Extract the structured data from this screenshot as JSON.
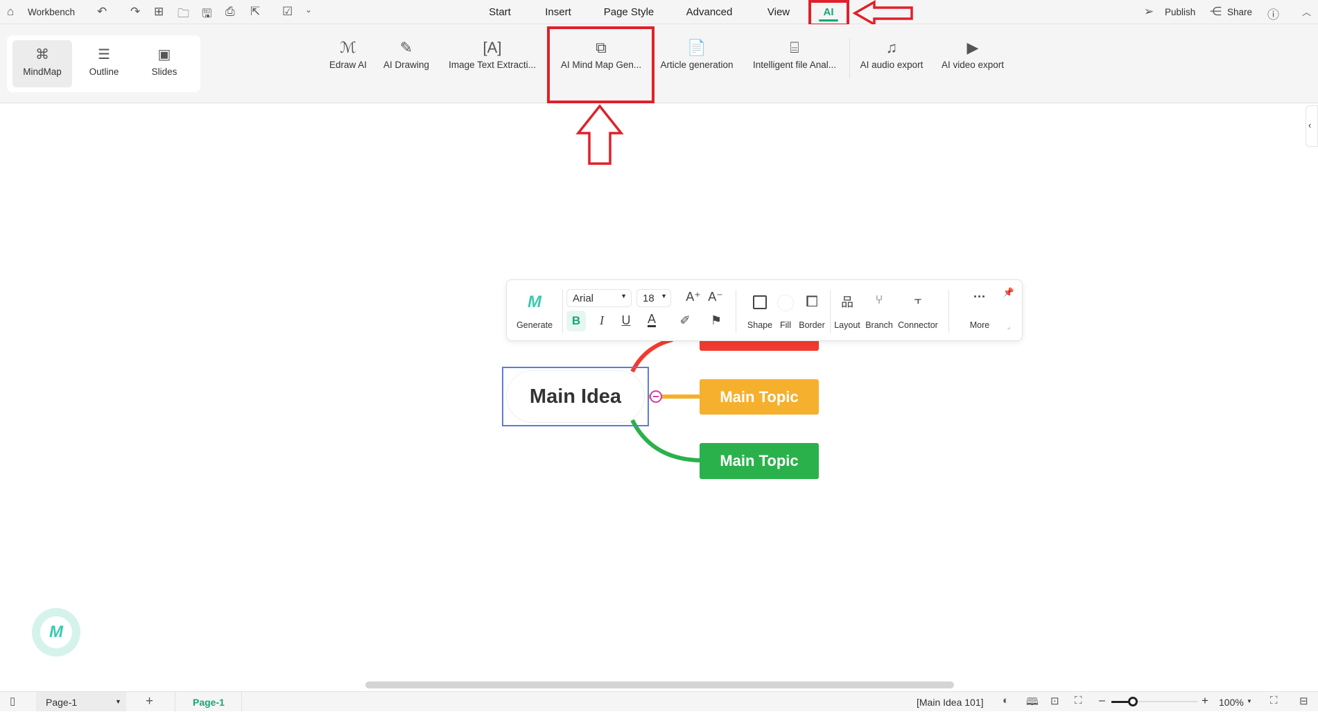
{
  "topbar": {
    "workbench": "Workbench",
    "menu": [
      "Start",
      "Insert",
      "Page Style",
      "Advanced",
      "View",
      "AI"
    ],
    "active_menu": "AI",
    "publish": "Publish",
    "share": "Share"
  },
  "views": [
    "MindMap",
    "Outline",
    "Slides"
  ],
  "ai_tools": [
    "Edraw AI",
    "AI Drawing",
    "Image Text Extracti...",
    "AI Mind Map Gen...",
    "Article generation",
    "Intelligent file Anal...",
    "AI audio export",
    "AI video export"
  ],
  "floating_toolbar": {
    "generate": "Generate",
    "font": "Arial",
    "size": "18",
    "bold": "B",
    "italic": "I",
    "underline": "U",
    "font_color": "A",
    "shape": "Shape",
    "fill": "Fill",
    "border": "Border",
    "layout": "Layout",
    "branch": "Branch",
    "connector": "Connector",
    "more": "More"
  },
  "mindmap": {
    "central": "Main Idea",
    "topics": [
      "Main Topic",
      "Main Topic"
    ],
    "colors": {
      "red": "#f23a2f",
      "yellow": "#f5b02e",
      "green": "#2bb14b",
      "selection": "#5b7bdc"
    }
  },
  "status": {
    "page_select": "Page-1",
    "page_tab": "Page-1",
    "selection": "[Main Idea 101]",
    "zoom": "100%",
    "zoom_level": 0.25
  },
  "accent": "#17a673",
  "annotation_color": "#e0202a"
}
